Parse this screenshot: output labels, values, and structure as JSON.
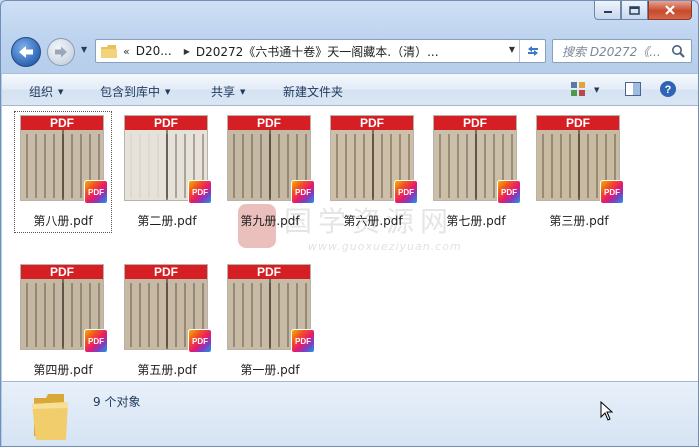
{
  "window": {
    "caption_buttons": [
      "minimize",
      "maximize",
      "close"
    ]
  },
  "address_bar": {
    "chevron": "«",
    "crumbs": [
      "D20...",
      "D20272《六书通十卷》天一阁藏本.（清）..."
    ]
  },
  "search": {
    "placeholder": "搜索 D20272《..."
  },
  "toolbar": {
    "organize": "组织",
    "include_in_library": "包含到库中",
    "share": "共享",
    "new_folder": "新建文件夹"
  },
  "files": [
    {
      "name": "第八册.pdf",
      "selected": true,
      "thumb_band": "PDF",
      "badge": "PDF"
    },
    {
      "name": "第二册.pdf",
      "selected": false,
      "thumb_band": "PDF",
      "badge": "PDF"
    },
    {
      "name": "第九册.pdf",
      "selected": false,
      "thumb_band": "PDF",
      "badge": "PDF"
    },
    {
      "name": "第六册.pdf",
      "selected": false,
      "thumb_band": "PDF",
      "badge": "PDF"
    },
    {
      "name": "第七册.pdf",
      "selected": false,
      "thumb_band": "PDF",
      "badge": "PDF"
    },
    {
      "name": "第三册.pdf",
      "selected": false,
      "thumb_band": "PDF",
      "badge": "PDF"
    },
    {
      "name": "第四册.pdf",
      "selected": false,
      "thumb_band": "PDF",
      "badge": "PDF"
    },
    {
      "name": "第五册.pdf",
      "selected": false,
      "thumb_band": "PDF",
      "badge": "PDF"
    },
    {
      "name": "第一册.pdf",
      "selected": false,
      "thumb_band": "PDF",
      "badge": "PDF"
    }
  ],
  "watermark": {
    "text": "国学资源网",
    "url": "www.guoxueziyuan.com"
  },
  "status": {
    "count_text": "9 个对象"
  },
  "colors": {
    "pdf_band": "#d61f24",
    "window_frame": "#b5cdeb",
    "close_button": "#c74a2c"
  }
}
